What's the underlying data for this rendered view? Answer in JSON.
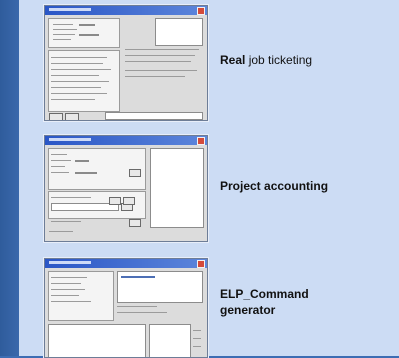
{
  "slides": [
    {
      "label_bold": "Real",
      "label_rest": " job ticketing"
    },
    {
      "label_bold": "Project accounting",
      "label_rest": ""
    },
    {
      "label_bold": "ELP_Command\ngenerator",
      "label_rest": ""
    }
  ],
  "colors": {
    "background": "#3d6db3",
    "panel": "#ccdcf4",
    "titlebar": "#2a56c6"
  }
}
